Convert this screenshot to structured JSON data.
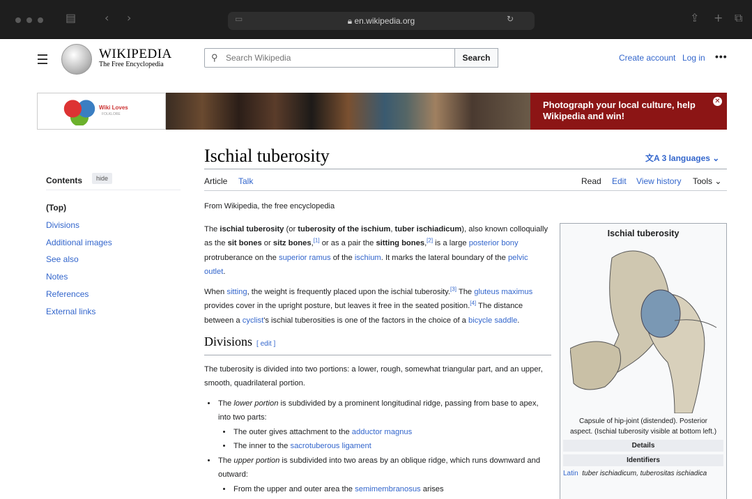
{
  "browser": {
    "url": "en.wikipedia.org"
  },
  "header": {
    "wordmark": "WIKIPEDIA",
    "tagline": "The Free Encyclopedia",
    "search_placeholder": "Search Wikipedia",
    "search_button": "Search",
    "create_account": "Create account",
    "login": "Log in"
  },
  "banner": {
    "logo_title": "Wiki Loves",
    "logo_sub": "FOLKLORE",
    "cta": "Photograph your local culture, help Wikipedia and win!"
  },
  "article": {
    "title": "Ischial tuberosity",
    "languages": "3 languages",
    "tabs": {
      "article": "Article",
      "talk": "Talk",
      "read": "Read",
      "edit": "Edit",
      "history": "View history",
      "tools": "Tools"
    },
    "from": "From Wikipedia, the free encyclopedia",
    "section_divisions": "Divisions",
    "edit_label": "edit"
  },
  "toc": {
    "heading": "Contents",
    "hide": "hide",
    "items": [
      "(Top)",
      "Divisions",
      "Additional images",
      "See also",
      "Notes",
      "References",
      "External links"
    ]
  },
  "infobox": {
    "title": "Ischial tuberosity",
    "caption": "Capsule of hip-joint (distended). Posterior aspect. (Ischial tuberosity visible at bottom left.)",
    "details": "Details",
    "identifiers": "Identifiers",
    "latin_label": "Latin",
    "latin_value": "tuber ischiadicum, tuberositas ischiadica"
  }
}
